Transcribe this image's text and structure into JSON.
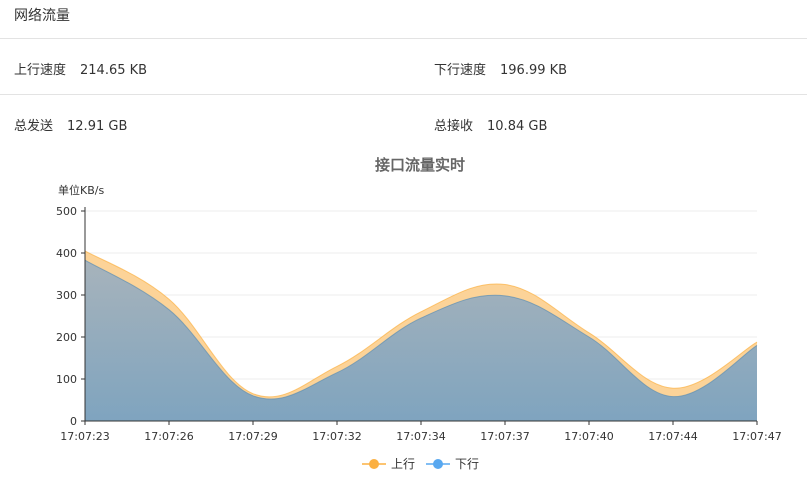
{
  "panel": {
    "title": "网络流量"
  },
  "stats": {
    "upload_speed": {
      "label": "上行速度",
      "value": "214.65 KB"
    },
    "download_speed": {
      "label": "下行速度",
      "value": "196.99 KB"
    },
    "total_sent": {
      "label": "总发送",
      "value": "12.91 GB"
    },
    "total_received": {
      "label": "总接收",
      "value": "10.84 GB"
    }
  },
  "chart_data": {
    "type": "area",
    "stacked": false,
    "title": "接口流量实时",
    "ylabel": "单位KB/s",
    "xlabel": "",
    "x": [
      "17:07:23",
      "17:07:26",
      "17:07:29",
      "17:07:32",
      "17:07:34",
      "17:07:37",
      "17:07:40",
      "17:07:44",
      "17:07:47"
    ],
    "ylim": [
      0,
      500
    ],
    "yticks": [
      0,
      100,
      200,
      300,
      400,
      500
    ],
    "grid": true,
    "legend_position": "bottom",
    "series": [
      {
        "name": "上行",
        "color": "#fbb042",
        "fill": "#fcd398",
        "values": [
          405,
          290,
          65,
          130,
          260,
          325,
          210,
          78,
          188
        ]
      },
      {
        "name": "下行",
        "color": "#58a8f0",
        "fill": "#8fa7b6",
        "values": [
          383,
          265,
          60,
          115,
          245,
          298,
          200,
          58,
          180
        ]
      }
    ]
  }
}
